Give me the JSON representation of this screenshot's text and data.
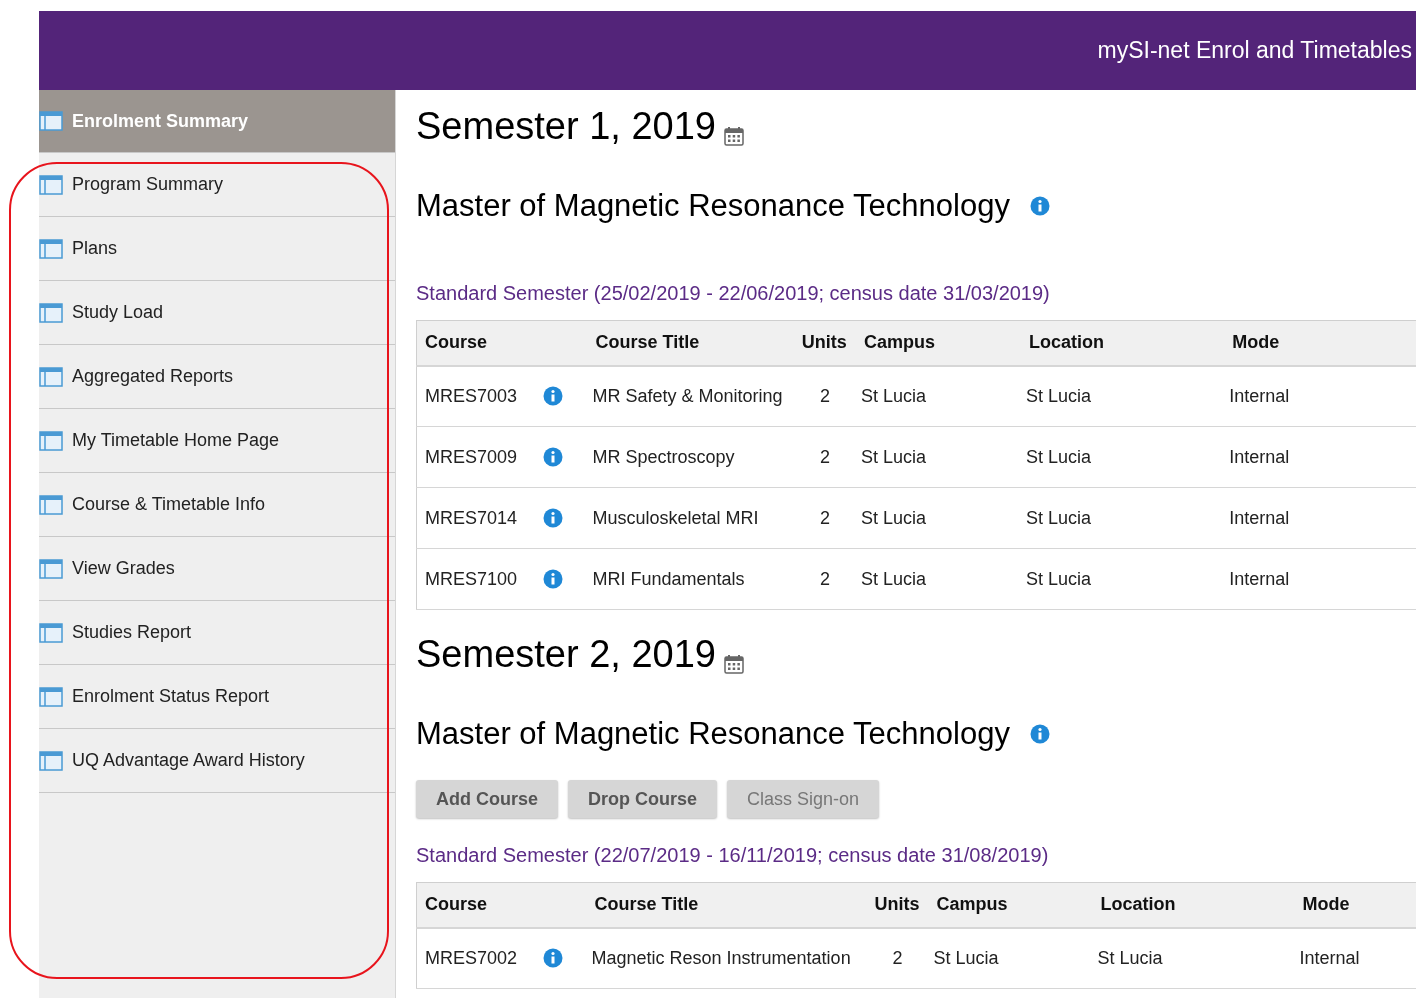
{
  "header": {
    "title": "mySI-net Enrol and Timetables"
  },
  "sidebar": {
    "items": [
      {
        "label": "Enrolment Summary",
        "selected": true
      },
      {
        "label": "Program Summary",
        "selected": false
      },
      {
        "label": "Plans",
        "selected": false
      },
      {
        "label": "Study Load",
        "selected": false
      },
      {
        "label": "Aggregated Reports",
        "selected": false
      },
      {
        "label": "My Timetable Home Page",
        "selected": false
      },
      {
        "label": "Course & Timetable Info",
        "selected": false
      },
      {
        "label": "View Grades",
        "selected": false
      },
      {
        "label": "Studies Report",
        "selected": false
      },
      {
        "label": "Enrolment Status Report",
        "selected": false
      },
      {
        "label": "UQ Advantage Award History",
        "selected": false
      }
    ]
  },
  "semesters": [
    {
      "heading": "Semester 1, 2019",
      "program": "Master of Magnetic Resonance Technology",
      "period": "Standard Semester (25/02/2019 - 22/06/2019; census date 31/03/2019)",
      "table": {
        "columns": [
          "Course",
          "Course Title",
          "Units",
          "Campus",
          "Location",
          "Mode"
        ],
        "rows": [
          {
            "course": "MRES7003",
            "title": "MR Safety & Monitoring",
            "units": "2",
            "campus": "St Lucia",
            "location": "St Lucia",
            "mode": "Internal"
          },
          {
            "course": "MRES7009",
            "title": "MR Spectroscopy",
            "units": "2",
            "campus": "St Lucia",
            "location": "St Lucia",
            "mode": "Internal"
          },
          {
            "course": "MRES7014",
            "title": "Musculoskeletal MRI",
            "units": "2",
            "campus": "St Lucia",
            "location": "St Lucia",
            "mode": "Internal"
          },
          {
            "course": "MRES7100",
            "title": "MRI Fundamentals",
            "units": "2",
            "campus": "St Lucia",
            "location": "St Lucia",
            "mode": "Internal"
          }
        ]
      }
    },
    {
      "heading": "Semester 2, 2019",
      "program": "Master of Magnetic Resonance Technology",
      "buttons": [
        {
          "label": "Add Course",
          "disabled": false
        },
        {
          "label": "Drop Course",
          "disabled": false
        },
        {
          "label": "Class Sign-on",
          "disabled": true
        }
      ],
      "period": "Standard Semester (22/07/2019 - 16/11/2019; census date 31/08/2019)",
      "table": {
        "columns": [
          "Course",
          "Course Title",
          "Units",
          "Campus",
          "Location",
          "Mode"
        ],
        "rows": [
          {
            "course": "MRES7002",
            "title": "Magnetic Reson Instrumentation",
            "units": "2",
            "campus": "St Lucia",
            "location": "St Lucia",
            "mode": "Internal"
          }
        ]
      }
    }
  ]
}
